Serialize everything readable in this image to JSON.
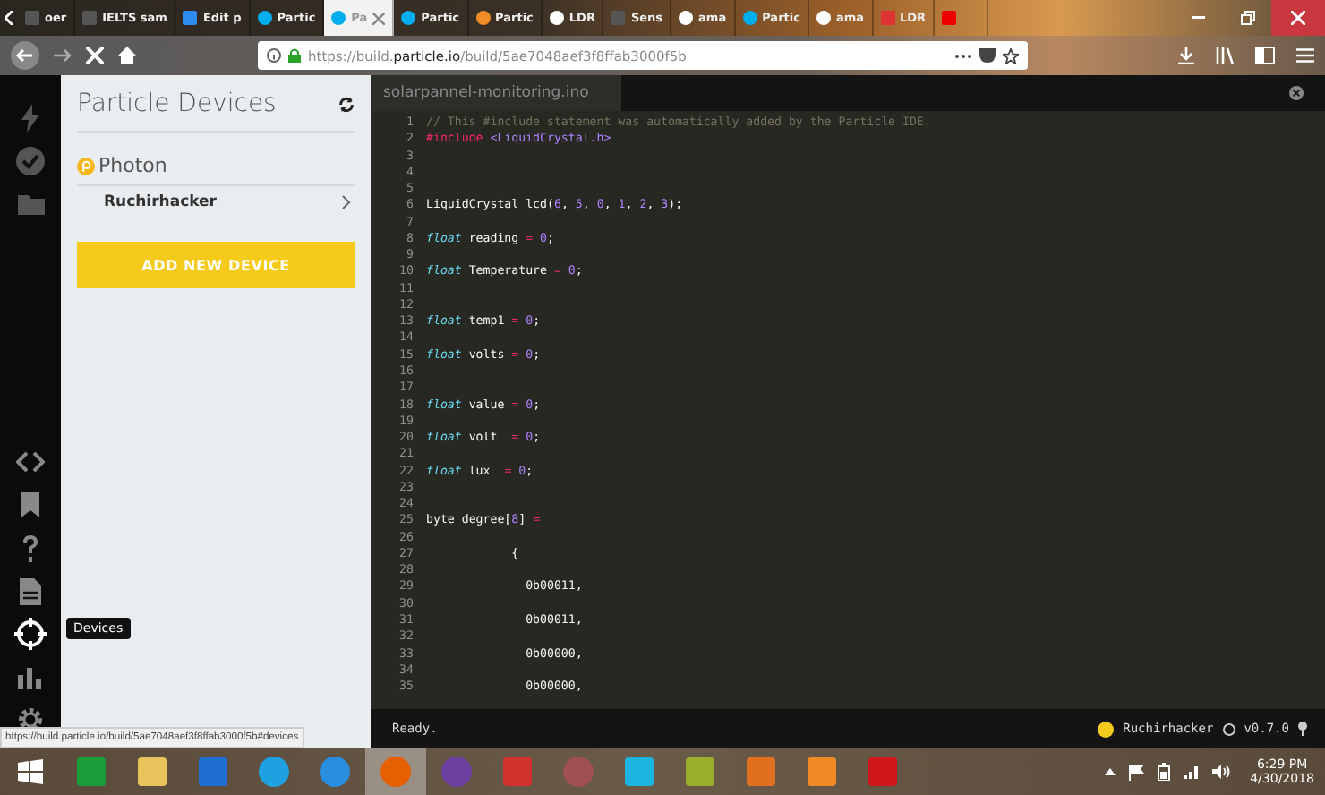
{
  "browser": {
    "tabs": [
      {
        "label": "oer",
        "selected": false,
        "kind": "page"
      },
      {
        "label": "IELTS sam",
        "selected": false,
        "kind": "page"
      },
      {
        "label": "Edit p",
        "selected": false,
        "kind": "edit"
      },
      {
        "label": "Partic",
        "selected": false,
        "kind": "particle"
      },
      {
        "label": "Pa",
        "selected": true,
        "kind": "dot"
      },
      {
        "label": "Partic",
        "selected": false,
        "kind": "dot"
      },
      {
        "label": "Partic",
        "selected": false,
        "kind": "sun"
      },
      {
        "label": "LDR",
        "selected": false,
        "kind": "google"
      },
      {
        "label": "Sens",
        "selected": false,
        "kind": "page"
      },
      {
        "label": "ama",
        "selected": false,
        "kind": "google"
      },
      {
        "label": "Partic",
        "selected": false,
        "kind": "dot"
      },
      {
        "label": "ama",
        "selected": false,
        "kind": "google"
      },
      {
        "label": "LDR",
        "selected": false,
        "kind": "s"
      },
      {
        "selected": false,
        "kind": "video"
      }
    ],
    "url": "https://build.**particle.io**/build/5ae7048aef3f8ffab3000f5b",
    "status_url": "https://build.particle.io/build/5ae7048aef3f8ffab3000f5b#devices"
  },
  "rail": {
    "top_items": [
      {
        "kind": "flash",
        "selected": false
      },
      {
        "kind": "verify",
        "selected": false
      },
      {
        "kind": "files",
        "selected": false
      }
    ],
    "bottom_items": [
      {
        "kind": "code",
        "selected": false
      },
      {
        "kind": "libraries",
        "selected": false
      },
      {
        "kind": "help",
        "selected": false
      },
      {
        "kind": "docs",
        "selected": false
      },
      {
        "kind": "devices",
        "selected": true
      },
      {
        "kind": "console",
        "selected": false
      },
      {
        "kind": "settings",
        "selected": false
      }
    ],
    "tooltip": "Devices"
  },
  "devices_panel": {
    "title": "Particle Devices",
    "groups": [
      {
        "name": "Photon",
        "devices": [
          {
            "name": "Ruchirhacker"
          }
        ]
      }
    ],
    "add_button": "ADD NEW DEVICE"
  },
  "editor": {
    "tab": "solarpannel-monitoring.ino",
    "lines": [
      {
        "number": "1",
        "tokens": [
          {
            "kind": "comment",
            "text": "// This #include statement was automatically added by the Particle IDE."
          }
        ]
      },
      {
        "number": "2",
        "tokens": [
          {
            "kind": "directive",
            "text": "#include"
          },
          {
            "kind": "string",
            "text": " <LiquidCrystal.h>"
          }
        ]
      },
      {
        "number": "3"
      },
      {
        "number": "4"
      },
      {
        "number": "5"
      },
      {
        "number": "6",
        "tokens": [
          {
            "kind": "plain",
            "text": "LiquidCrystal lcd("
          },
          {
            "kind": "number",
            "text": "6"
          },
          {
            "kind": "plain",
            "text": ", "
          },
          {
            "kind": "number",
            "text": "5"
          },
          {
            "kind": "plain",
            "text": ", "
          },
          {
            "kind": "number",
            "text": "0"
          },
          {
            "kind": "plain",
            "text": ", "
          },
          {
            "kind": "number",
            "text": "1"
          },
          {
            "kind": "plain",
            "text": ", "
          },
          {
            "kind": "number",
            "text": "2"
          },
          {
            "kind": "plain",
            "text": ", "
          },
          {
            "kind": "number",
            "text": "3"
          },
          {
            "kind": "plain",
            "text": ");"
          }
        ]
      },
      {
        "number": "7"
      },
      {
        "number": "8",
        "tokens": [
          {
            "kind": "type",
            "text": "float"
          },
          {
            "kind": "plain",
            "text": " reading "
          },
          {
            "kind": "operator",
            "text": "="
          },
          {
            "kind": "number",
            "text": " 0"
          },
          {
            "kind": "plain",
            "text": ";"
          }
        ]
      },
      {
        "number": "9"
      },
      {
        "number": "10",
        "tokens": [
          {
            "kind": "type",
            "text": "float"
          },
          {
            "kind": "plain",
            "text": " Temperature "
          },
          {
            "kind": "operator",
            "text": "="
          },
          {
            "kind": "number",
            "text": " 0"
          },
          {
            "kind": "plain",
            "text": ";"
          }
        ]
      },
      {
        "number": "11"
      },
      {
        "number": "12"
      },
      {
        "number": "13",
        "tokens": [
          {
            "kind": "type",
            "text": "float"
          },
          {
            "kind": "plain",
            "text": " temp1 "
          },
          {
            "kind": "operator",
            "text": "="
          },
          {
            "kind": "number",
            "text": " 0"
          },
          {
            "kind": "plain",
            "text": ";"
          }
        ]
      },
      {
        "number": "14"
      },
      {
        "number": "15",
        "tokens": [
          {
            "kind": "type",
            "text": "float"
          },
          {
            "kind": "plain",
            "text": " volts "
          },
          {
            "kind": "operator",
            "text": "="
          },
          {
            "kind": "number",
            "text": " 0"
          },
          {
            "kind": "plain",
            "text": ";"
          }
        ]
      },
      {
        "number": "16"
      },
      {
        "number": "17"
      },
      {
        "number": "18",
        "tokens": [
          {
            "kind": "type",
            "text": "float"
          },
          {
            "kind": "plain",
            "text": " value "
          },
          {
            "kind": "operator",
            "text": "="
          },
          {
            "kind": "number",
            "text": " 0"
          },
          {
            "kind": "plain",
            "text": ";"
          }
        ]
      },
      {
        "number": "19"
      },
      {
        "number": "20",
        "tokens": [
          {
            "kind": "type",
            "text": "float"
          },
          {
            "kind": "plain",
            "text": " volt  "
          },
          {
            "kind": "operator",
            "text": "="
          },
          {
            "kind": "number",
            "text": " 0"
          },
          {
            "kind": "plain",
            "text": ";"
          }
        ]
      },
      {
        "number": "21"
      },
      {
        "number": "22",
        "tokens": [
          {
            "kind": "type",
            "text": "float"
          },
          {
            "kind": "plain",
            "text": " lux  "
          },
          {
            "kind": "operator",
            "text": "="
          },
          {
            "kind": "number",
            "text": " 0"
          },
          {
            "kind": "plain",
            "text": ";"
          }
        ]
      },
      {
        "number": "23"
      },
      {
        "number": "24"
      },
      {
        "number": "25",
        "tokens": [
          {
            "kind": "plain",
            "text": "byte degree["
          },
          {
            "kind": "number",
            "text": "8"
          },
          {
            "kind": "plain",
            "text": "] "
          },
          {
            "kind": "operator",
            "text": "="
          }
        ]
      },
      {
        "number": "26"
      },
      {
        "number": "27",
        "tokens": [
          {
            "kind": "plain",
            "text": "            {"
          }
        ]
      },
      {
        "number": "28"
      },
      {
        "number": "29",
        "tokens": [
          {
            "kind": "plain",
            "text": "              0b00011,"
          }
        ]
      },
      {
        "number": "30"
      },
      {
        "number": "31",
        "tokens": [
          {
            "kind": "plain",
            "text": "              0b00011,"
          }
        ]
      },
      {
        "number": "32"
      },
      {
        "number": "33",
        "tokens": [
          {
            "kind": "plain",
            "text": "              0b00000,"
          }
        ]
      },
      {
        "number": "34"
      },
      {
        "number": "35",
        "tokens": [
          {
            "kind": "plain",
            "text": "              0b00000,"
          }
        ]
      }
    ]
  },
  "status_bar": {
    "message": "Ready.",
    "device": "Ruchirhacker",
    "version": "v0.7.0"
  },
  "taskbar": {
    "apps": [
      {
        "kind": "store",
        "selected": false
      },
      {
        "kind": "explorer",
        "selected": false
      },
      {
        "kind": "shield",
        "selected": false
      },
      {
        "kind": "skype",
        "selected": false
      },
      {
        "kind": "ie",
        "selected": false
      },
      {
        "kind": "firefox",
        "selected": true
      },
      {
        "kind": "purple",
        "selected": false
      },
      {
        "kind": "red",
        "selected": false
      },
      {
        "kind": "gem",
        "selected": false
      },
      {
        "kind": "cyan",
        "selected": false
      },
      {
        "kind": "leaf",
        "selected": false
      },
      {
        "kind": "matlab",
        "selected": false
      },
      {
        "kind": "sublime",
        "selected": false
      },
      {
        "kind": "pin",
        "selected": false
      }
    ],
    "time": "6:29 PM",
    "date": "4/30/2018"
  }
}
